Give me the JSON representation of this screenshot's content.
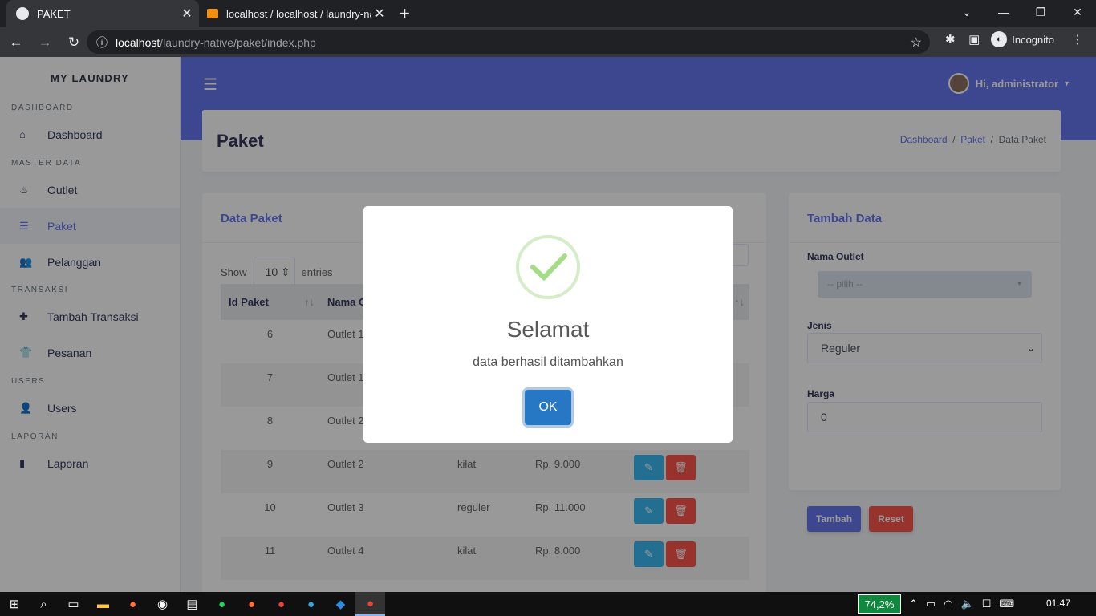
{
  "browser": {
    "tabs": [
      {
        "title": "PAKET",
        "active": true
      },
      {
        "title": "localhost / localhost / laundry-na",
        "active": false
      }
    ],
    "url_host": "localhost",
    "url_path": "/laundry-native/paket/index.php",
    "profile": "Incognito"
  },
  "sidebar": {
    "brand": "MY LAUNDRY",
    "sections": [
      {
        "title": "DASHBOARD",
        "items": [
          {
            "label": "Dashboard",
            "icon": "home-icon"
          }
        ]
      },
      {
        "title": "MASTER DATA",
        "items": [
          {
            "label": "Outlet",
            "icon": "fire-icon"
          },
          {
            "label": "Paket",
            "icon": "list-icon",
            "active": true
          },
          {
            "label": "Pelanggan",
            "icon": "users-icon"
          }
        ]
      },
      {
        "title": "TRANSAKSI",
        "items": [
          {
            "label": "Tambah Transaksi",
            "icon": "plus-icon"
          },
          {
            "label": "Pesanan",
            "icon": "shirt-icon"
          }
        ]
      },
      {
        "title": "USERS",
        "items": [
          {
            "label": "Users",
            "icon": "user-icon"
          }
        ]
      },
      {
        "title": "LAPORAN",
        "items": [
          {
            "label": "Laporan",
            "icon": "file-icon"
          }
        ]
      }
    ]
  },
  "topbar": {
    "user": "Hi, administrator"
  },
  "header": {
    "title": "Paket",
    "breadcrumb": [
      "Dashboard",
      "Paket",
      "Data Paket"
    ]
  },
  "table_card": {
    "title": "Data Paket",
    "show_label": "Show",
    "entries_value": "10",
    "entries_label": "entries",
    "columns": [
      "Id Paket",
      "Nama Ou"
    ],
    "rows": [
      {
        "id": "6",
        "outlet": "Outlet 1",
        "jenis": "",
        "harga": ""
      },
      {
        "id": "7",
        "outlet": "Outlet 1",
        "jenis": "",
        "harga": ""
      },
      {
        "id": "8",
        "outlet": "Outlet 2",
        "jenis": "",
        "harga": ""
      },
      {
        "id": "9",
        "outlet": "Outlet 2",
        "jenis": "kilat",
        "harga": "Rp. 9.000"
      },
      {
        "id": "10",
        "outlet": "Outlet 3",
        "jenis": "reguler",
        "harga": "Rp. 11.000"
      },
      {
        "id": "11",
        "outlet": "Outlet 4",
        "jenis": "kilat",
        "harga": "Rp. 8.000"
      }
    ]
  },
  "form_card": {
    "title": "Tambah Data",
    "outlet_label": "Nama Outlet",
    "outlet_placeholder": "-- pilih --",
    "jenis_label": "Jenis",
    "jenis_value": "Reguler",
    "harga_label": "Harga",
    "harga_value": "0",
    "submit_label": "Tambah",
    "reset_label": "Reset"
  },
  "modal": {
    "title": "Selamat",
    "message": "data berhasil ditambahkan",
    "ok_label": "OK"
  },
  "taskbar": {
    "battery": "74,2%",
    "time": "01.47"
  },
  "colors": {
    "primary": "#6777ef",
    "info": "#3abaf4",
    "danger": "#fc544b",
    "ok_button": "#2778c4"
  }
}
